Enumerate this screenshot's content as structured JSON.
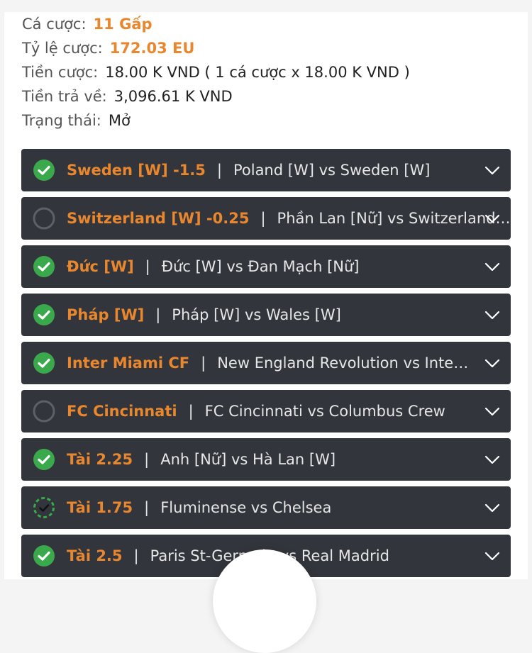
{
  "summary": {
    "bet_type": {
      "label": "Cá cược:",
      "value": "11 Gấp"
    },
    "odds": {
      "label": "Tỷ lệ cược:",
      "value": "172.03 EU"
    },
    "stake": {
      "label": "Tiền cược:",
      "value": "18.00 K VND ( 1 cá cược x 18.00 K VND )"
    },
    "payout": {
      "label": "Tiền trả về:",
      "value": "3,096.61 K VND"
    },
    "status": {
      "label": "Trạng thái:",
      "value": "Mở"
    }
  },
  "colors": {
    "accent": "#e8872e",
    "won": "#3aa94b",
    "card": "#32353b"
  },
  "bets": [
    {
      "pick": "Sweden [W] -1.5",
      "match": "Poland [W] vs Sweden [W]",
      "state": "won"
    },
    {
      "pick": "Switzerland [W] -0.25",
      "match": "Phần Lan [Nữ] vs Switzerland [W]",
      "state": "pending"
    },
    {
      "pick": "Đức [W]",
      "match": "Đức [W] vs Đan Mạch [Nữ]",
      "state": "won"
    },
    {
      "pick": "Pháp [W]",
      "match": "Pháp [W] vs Wales [W]",
      "state": "won"
    },
    {
      "pick": "Inter Miami CF",
      "match": "New England Revolution vs Inter Miami CF",
      "state": "won"
    },
    {
      "pick": "FC Cincinnati",
      "match": "FC Cincinnati vs Columbus Crew",
      "state": "pending"
    },
    {
      "pick": "Tài 2.25",
      "match": "Anh [Nữ] vs Hà Lan [W]",
      "state": "won"
    },
    {
      "pick": "Tài 1.75",
      "match": "Fluminense vs Chelsea",
      "state": "half-won"
    },
    {
      "pick": "Tài 2.5",
      "match": "Paris St-Germain vs Real Madrid",
      "state": "won"
    }
  ]
}
